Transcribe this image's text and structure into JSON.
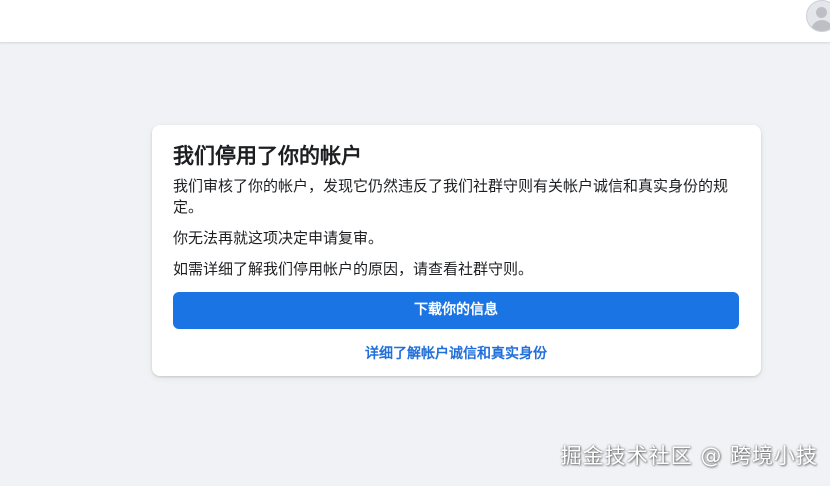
{
  "dialog": {
    "title": "我们停用了你的帐户",
    "paragraph_1": "我们审核了你的帐户，发现它仍然违反了我们社群守则有关帐户诚信和真实身份的规定。",
    "paragraph_2": "你无法再就这项决定申请复审。",
    "paragraph_3": "如需详细了解我们停用帐户的原因，请查看社群守则。",
    "download_button_label": "下载你的信息",
    "learn_more_link": "详细了解帐户诚信和真实身份"
  },
  "watermark": "掘金技术社区 @ 跨境小技",
  "colors": {
    "page_background": "#f0f2f5",
    "primary_button": "#1b74e4",
    "link": "#216fdb",
    "text": "#1c1e21"
  },
  "icons": {
    "account": "avatar-icon"
  }
}
